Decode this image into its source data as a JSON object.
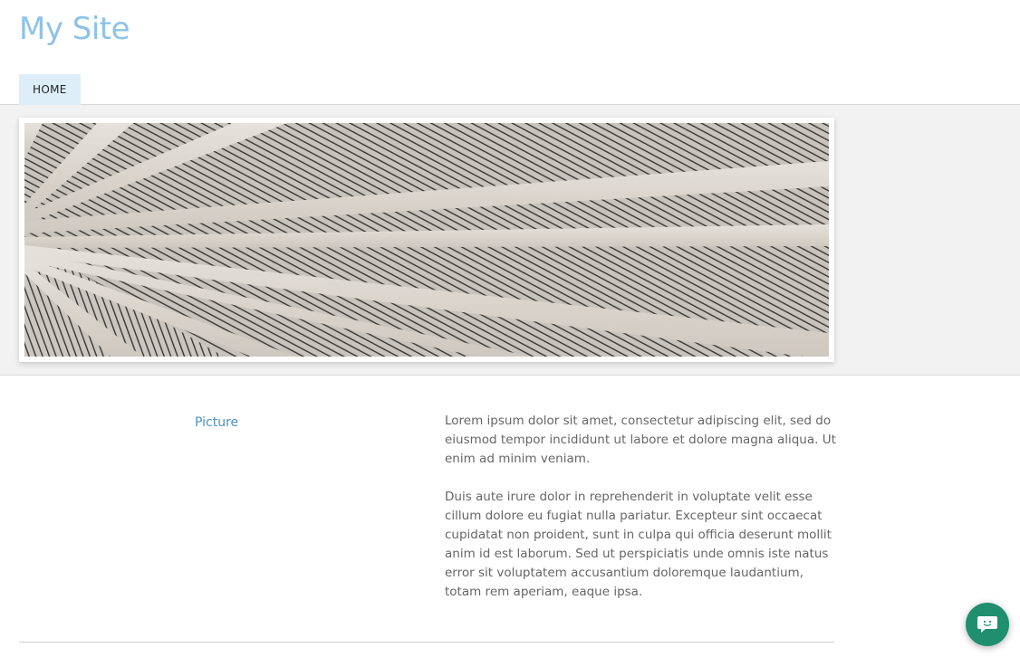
{
  "header": {
    "site_title": "My Site",
    "nav": [
      {
        "label": "HOME"
      }
    ]
  },
  "banner": {
    "image": "wooden-ceiling-beams-image"
  },
  "content": {
    "picture_link": "Picture",
    "paragraphs": [
      "Lorem ipsum dolor sit amet, consectetur adipiscing elit, sed do eiusmod tempor incididunt ut labore et dolore magna aliqua. Ut enim ad minim veniam.",
      "Duis aute irure dolor in reprehenderit in voluptate velit esse cillum dolore eu fugiat nulla pariatur. Excepteur sint occaecat cupidatat non proident, sunt in culpa qui officia deserunt mollit anim id est laborum. Sed ut perspiciatis unde omnis iste natus error sit voluptatem accusantium doloremque laudantium, totam rem aperiam, eaque ipsa."
    ]
  },
  "chat": {
    "icon": "chat-smiley-icon"
  },
  "colors": {
    "title": "#8dc3ea",
    "nav_active_bg": "#ddeef9",
    "link": "#4a90c8",
    "body_text": "#666666",
    "band_bg": "#f2f2f2",
    "chat_bg": "#1f8f6e"
  }
}
